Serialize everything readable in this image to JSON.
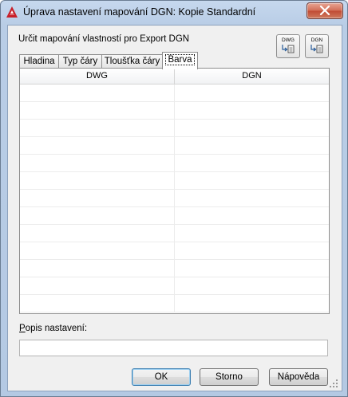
{
  "window": {
    "title": "Úprava nastavení mapování DGN: Kopie Standardní"
  },
  "heading": "Určit mapování vlastností pro Export DGN",
  "icon_buttons": [
    {
      "label": "DWG",
      "icon": "dwg-to-dgn-icon"
    },
    {
      "label": "DGN",
      "icon": "dgn-to-dwg-icon"
    }
  ],
  "tabs": [
    {
      "label": "Hladina",
      "active": false
    },
    {
      "label": "Typ čáry",
      "active": false
    },
    {
      "label": "Tloušťka čáry",
      "active": false
    },
    {
      "label": "Barva",
      "active": true
    }
  ],
  "grid": {
    "columns": [
      "DWG",
      "DGN"
    ],
    "rows": [
      [
        "",
        ""
      ],
      [
        "",
        ""
      ],
      [
        "",
        ""
      ],
      [
        "",
        ""
      ],
      [
        "",
        ""
      ],
      [
        "",
        ""
      ],
      [
        "",
        ""
      ],
      [
        "",
        ""
      ],
      [
        "",
        ""
      ],
      [
        "",
        ""
      ],
      [
        "",
        ""
      ],
      [
        "",
        ""
      ],
      [
        "",
        ""
      ]
    ]
  },
  "description": {
    "label_underlined": "P",
    "label_rest": "opis nastavení:",
    "value": ""
  },
  "buttons": {
    "ok": "OK",
    "cancel": "Storno",
    "help": "Nápověda"
  },
  "colors": {
    "accent": "#3c7fb1",
    "close": "#c04b34",
    "logo": "#c8202a"
  }
}
